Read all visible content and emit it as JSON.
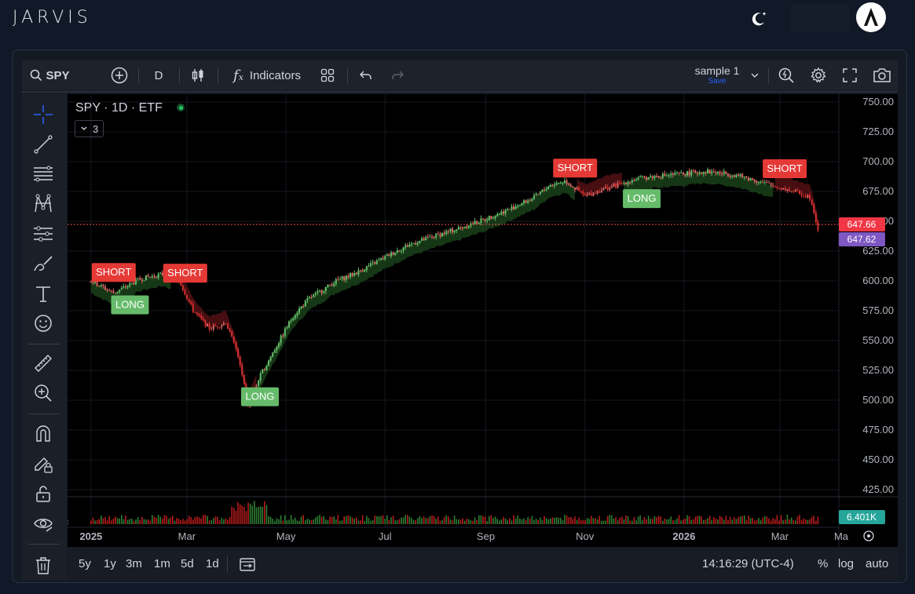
{
  "app": {
    "brand": "JARVIS"
  },
  "toolbar": {
    "symbol": "SPY",
    "interval": "D",
    "indicators_label": "Indicators",
    "layout_name": "sample 1",
    "layout_status": "Save"
  },
  "legend": {
    "title": "SPY · 1D · ETF",
    "collapsed_count": "3"
  },
  "chart_data": {
    "type": "line",
    "price_axis_ticks": [
      "750.00",
      "725.00",
      "700.00",
      "675.00",
      "650.00",
      "625.00",
      "600.00",
      "575.00",
      "550.00",
      "525.00",
      "500.00",
      "475.00",
      "450.00",
      "425.00"
    ],
    "price_axis_range": [
      425,
      750
    ],
    "time_axis_labels": [
      "2025",
      "Mar",
      "May",
      "Jul",
      "Sep",
      "Nov",
      "2026",
      "Mar",
      "Ma"
    ],
    "last_price": "647.66",
    "second_price": "647.62",
    "volume_label": "6.401K",
    "series": [
      {
        "x": [
          "2025-01-01",
          "2025-01-15",
          "2025-02-01",
          "2025-02-15",
          "2025-02-25",
          "2025-03-05",
          "2025-03-15",
          "2025-03-25",
          "2025-04-01",
          "2025-04-08",
          "2025-04-15",
          "2025-04-25",
          "2025-05-05",
          "2025-05-15",
          "2025-06-01",
          "2025-06-15",
          "2025-07-01",
          "2025-07-15",
          "2025-08-01",
          "2025-08-15",
          "2025-09-01",
          "2025-09-15",
          "2025-10-01",
          "2025-10-10",
          "2025-10-20",
          "2025-11-01",
          "2025-11-10",
          "2025-11-20",
          "2025-12-01",
          "2025-12-15",
          "2026-01-01",
          "2026-01-15",
          "2026-02-01",
          "2026-02-15",
          "2026-03-01",
          "2026-03-10",
          "2026-03-20",
          "2026-03-25"
        ],
        "values": [
          600,
          590,
          602,
          606,
          598,
          575,
          560,
          565,
          540,
          495,
          520,
          545,
          570,
          585,
          600,
          608,
          620,
          630,
          638,
          644,
          652,
          660,
          670,
          680,
          684,
          671,
          676,
          680,
          685,
          688,
          690,
          692,
          689,
          684,
          678,
          675,
          670,
          640
        ]
      }
    ],
    "annotations": [
      {
        "label": "SHORT",
        "x": "2025-01-15"
      },
      {
        "label": "LONG",
        "x": "2025-01-25"
      },
      {
        "label": "SHORT",
        "x": "2025-02-28"
      },
      {
        "label": "LONG",
        "x": "2025-04-15"
      },
      {
        "label": "SHORT",
        "x": "2025-10-26"
      },
      {
        "label": "LONG",
        "x": "2025-12-06"
      },
      {
        "label": "SHORT",
        "x": "2026-03-04"
      }
    ]
  },
  "bottombar": {
    "ranges": [
      "5y",
      "1y",
      "3m",
      "1m",
      "5d",
      "1d"
    ],
    "time": "14:16:29 (UTC-4)",
    "percent": "%",
    "log": "log",
    "auto": "auto"
  }
}
